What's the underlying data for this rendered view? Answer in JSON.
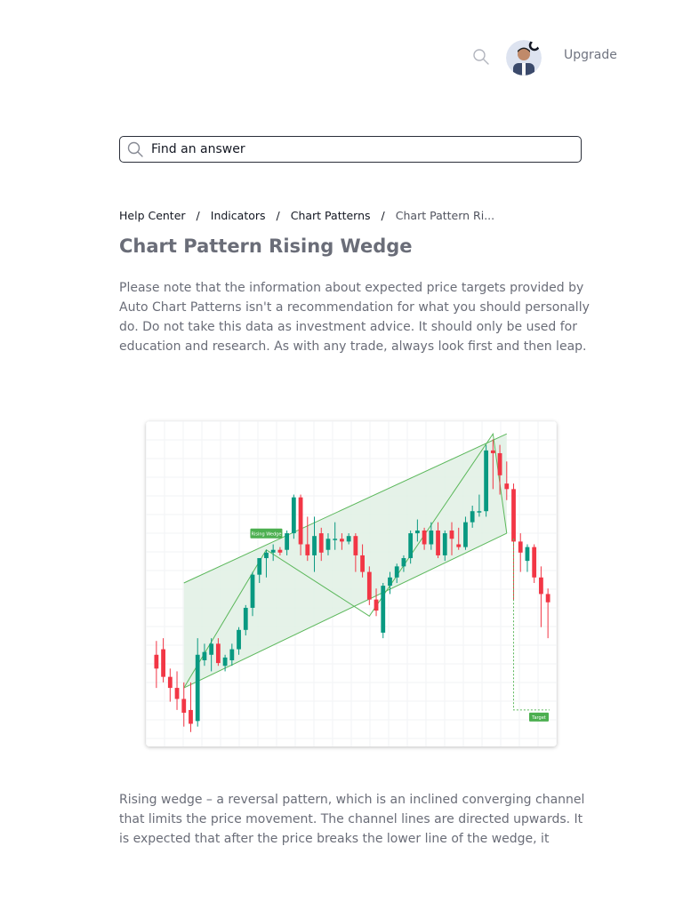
{
  "header": {
    "upgrade_label": "Upgrade",
    "icons": {
      "search": "search-icon",
      "avatar": "avatar"
    }
  },
  "search": {
    "placeholder": "Find an answer",
    "icon": "search-icon"
  },
  "breadcrumb": {
    "items": [
      "Help Center",
      "Indicators",
      "Chart Patterns"
    ],
    "current": "Chart Pattern Ri...",
    "separator": "/"
  },
  "article": {
    "title": "Chart Pattern Rising Wedge",
    "disclaimer": "Please note that the information about expected price targets provided by Auto Chart Patterns isn't a recommendation for what you should personally do. Do not take this data as investment advice. It should only be used for education and research. As with any trade, always look first and then leap.",
    "description": "Rising wedge – a reversal pattern, which is an inclined converging channel that limits the price movement. The channel lines are directed upwards. It is expected that after the price breaks the lower line of the wedge, it"
  },
  "chart_data": {
    "type": "candlestick",
    "labels": {
      "pattern": "Rising Wedge",
      "target": "Target"
    },
    "colors": {
      "up": "#089981",
      "down": "#f23645",
      "pattern_fill": "#e0f0e4",
      "pattern_line": "#5cb85c",
      "label_bg": "#4caf50"
    },
    "y_range": [
      0,
      100
    ],
    "candles": [
      {
        "o": 50,
        "h": 55,
        "l": 38,
        "c": 45
      },
      {
        "o": 52,
        "h": 56,
        "l": 40,
        "c": 42
      },
      {
        "o": 42,
        "h": 45,
        "l": 33,
        "c": 38
      },
      {
        "o": 38,
        "h": 44,
        "l": 30,
        "c": 34
      },
      {
        "o": 34,
        "h": 40,
        "l": 24,
        "c": 29
      },
      {
        "o": 30,
        "h": 40,
        "l": 22,
        "c": 25
      },
      {
        "o": 26,
        "h": 56,
        "l": 24,
        "c": 50
      },
      {
        "o": 48,
        "h": 54,
        "l": 46,
        "c": 51
      },
      {
        "o": 50,
        "h": 56,
        "l": 44,
        "c": 54
      },
      {
        "o": 54,
        "h": 56,
        "l": 46,
        "c": 47
      },
      {
        "o": 46,
        "h": 50,
        "l": 44,
        "c": 49
      },
      {
        "o": 48,
        "h": 54,
        "l": 46,
        "c": 52
      },
      {
        "o": 52,
        "h": 60,
        "l": 50,
        "c": 59
      },
      {
        "o": 59,
        "h": 68,
        "l": 57,
        "c": 67
      },
      {
        "o": 67,
        "h": 80,
        "l": 64,
        "c": 79
      },
      {
        "o": 79,
        "h": 85,
        "l": 76,
        "c": 85
      },
      {
        "o": 85,
        "h": 88,
        "l": 78,
        "c": 87
      },
      {
        "o": 87,
        "h": 90,
        "l": 84,
        "c": 88
      },
      {
        "o": 88,
        "h": 89,
        "l": 86,
        "c": 87
      },
      {
        "o": 88,
        "h": 95,
        "l": 86,
        "c": 94
      },
      {
        "o": 94,
        "h": 108,
        "l": 92,
        "c": 107
      },
      {
        "o": 107,
        "h": 108,
        "l": 86,
        "c": 90
      },
      {
        "o": 90,
        "h": 100,
        "l": 84,
        "c": 86
      },
      {
        "o": 86,
        "h": 100,
        "l": 80,
        "c": 93
      },
      {
        "o": 94,
        "h": 96,
        "l": 84,
        "c": 87
      },
      {
        "o": 88,
        "h": 94,
        "l": 86,
        "c": 92
      },
      {
        "o": 92,
        "h": 98,
        "l": 88,
        "c": 92
      },
      {
        "o": 92,
        "h": 94,
        "l": 88,
        "c": 91
      },
      {
        "o": 91,
        "h": 94,
        "l": 90,
        "c": 93
      },
      {
        "o": 93,
        "h": 94,
        "l": 80,
        "c": 86
      },
      {
        "o": 86,
        "h": 90,
        "l": 78,
        "c": 80
      },
      {
        "o": 80,
        "h": 82,
        "l": 68,
        "c": 70
      },
      {
        "o": 70,
        "h": 74,
        "l": 64,
        "c": 66
      },
      {
        "o": 58,
        "h": 76,
        "l": 56,
        "c": 75
      },
      {
        "o": 75,
        "h": 80,
        "l": 72,
        "c": 78
      },
      {
        "o": 78,
        "h": 83,
        "l": 76,
        "c": 82
      },
      {
        "o": 82,
        "h": 86,
        "l": 80,
        "c": 85
      },
      {
        "o": 85,
        "h": 95,
        "l": 83,
        "c": 94
      },
      {
        "o": 94,
        "h": 99,
        "l": 91,
        "c": 95
      },
      {
        "o": 95,
        "h": 96,
        "l": 88,
        "c": 90
      },
      {
        "o": 90,
        "h": 98,
        "l": 88,
        "c": 95
      },
      {
        "o": 95,
        "h": 98,
        "l": 85,
        "c": 86
      },
      {
        "o": 86,
        "h": 95,
        "l": 84,
        "c": 94
      },
      {
        "o": 95,
        "h": 98,
        "l": 86,
        "c": 92
      },
      {
        "o": 90,
        "h": 96,
        "l": 88,
        "c": 89
      },
      {
        "o": 89,
        "h": 100,
        "l": 88,
        "c": 98
      },
      {
        "o": 98,
        "h": 104,
        "l": 96,
        "c": 102
      },
      {
        "o": 102,
        "h": 108,
        "l": 100,
        "c": 102
      },
      {
        "o": 102,
        "h": 126,
        "l": 100,
        "c": 124
      },
      {
        "o": 124,
        "h": 128,
        "l": 110,
        "c": 123
      },
      {
        "o": 123,
        "h": 126,
        "l": 108,
        "c": 115
      },
      {
        "o": 112,
        "h": 120,
        "l": 106,
        "c": 110
      },
      {
        "o": 110,
        "h": 112,
        "l": 70,
        "c": 91
      },
      {
        "o": 91,
        "h": 94,
        "l": 80,
        "c": 87
      },
      {
        "o": 84,
        "h": 90,
        "l": 80,
        "c": 89
      },
      {
        "o": 89,
        "h": 90,
        "l": 76,
        "c": 78
      },
      {
        "o": 78,
        "h": 82,
        "l": 60,
        "c": 72
      },
      {
        "o": 72,
        "h": 74,
        "l": 56,
        "c": 69
      }
    ],
    "wedge": {
      "upper": [
        [
          4,
          76
        ],
        [
          51,
          130
        ]
      ],
      "lower": [
        [
          4,
          38
        ],
        [
          51,
          94
        ]
      ],
      "zigzag": [
        [
          4,
          38
        ],
        [
          16,
          88
        ],
        [
          31,
          64
        ],
        [
          49,
          130
        ],
        [
          51,
          94
        ]
      ]
    },
    "target_value": 30
  }
}
